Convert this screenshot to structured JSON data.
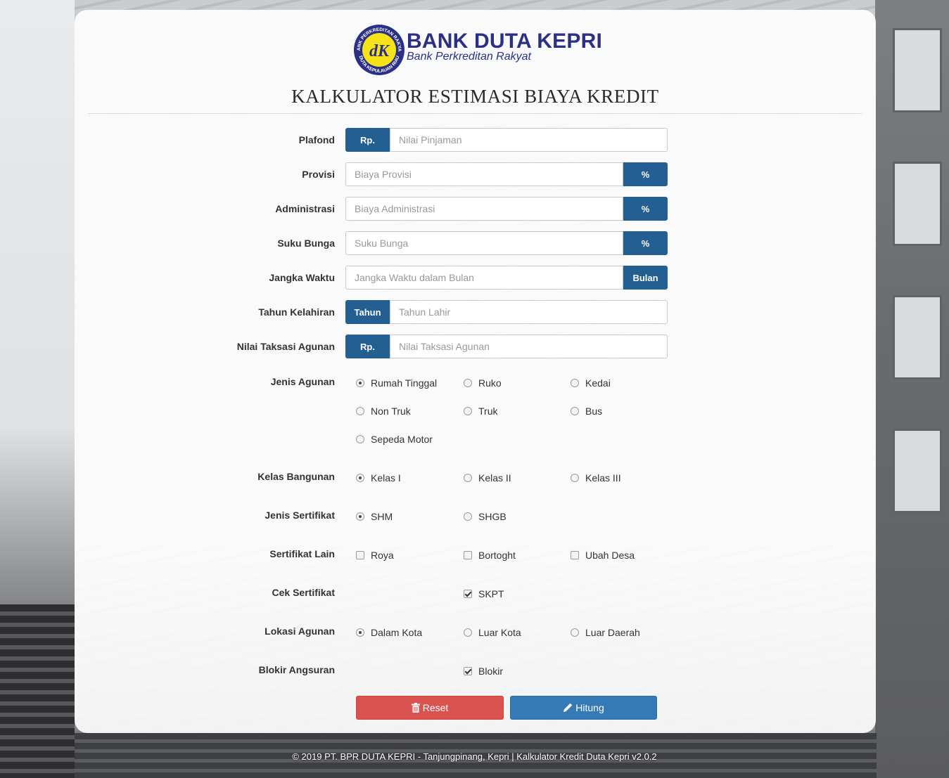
{
  "brand": {
    "name": "BANK DUTA KEPRI",
    "subtitle": "Bank Perkreditan Rakyat",
    "badge_top_text": "BANK PERKREDITAN RAKYAT",
    "badge_bottom_text": "DUTA KEPULAUAN RIAU",
    "badge_initials": "dK"
  },
  "page_title": "KALKULATOR ESTIMASI BIAYA KREDIT",
  "fields": {
    "plafond": {
      "label": "Plafond",
      "addon": "Rp.",
      "placeholder": "Nilai Pinjaman",
      "value": ""
    },
    "provisi": {
      "label": "Provisi",
      "addon": "%",
      "placeholder": "Biaya Provisi",
      "value": ""
    },
    "administrasi": {
      "label": "Administrasi",
      "addon": "%",
      "placeholder": "Biaya Administrasi",
      "value": ""
    },
    "suku_bunga": {
      "label": "Suku Bunga",
      "addon": "%",
      "placeholder": "Suku Bunga",
      "value": ""
    },
    "jangka_waktu": {
      "label": "Jangka Waktu",
      "addon": "Bulan",
      "placeholder": "Jangka Waktu dalam Bulan",
      "value": ""
    },
    "tahun_kelahiran": {
      "label": "Tahun Kelahiran",
      "addon": "Tahun",
      "placeholder": "Tahun Lahir",
      "value": ""
    },
    "nilai_taksasi": {
      "label": "Nilai Taksasi Agunan",
      "addon": "Rp.",
      "placeholder": "Nilai Taksasi Agunan",
      "value": ""
    }
  },
  "jenis_agunan": {
    "label": "Jenis Agunan",
    "options": [
      "Rumah Tinggal",
      "Ruko",
      "Kedai",
      "Non Truk",
      "Truk",
      "Bus",
      "Sepeda Motor"
    ],
    "selected": "Rumah Tinggal"
  },
  "kelas_bangunan": {
    "label": "Kelas Bangunan",
    "options": [
      "Kelas I",
      "Kelas II",
      "Kelas III"
    ],
    "selected": "Kelas I"
  },
  "jenis_sertifikat": {
    "label": "Jenis Sertifikat",
    "options": [
      "SHM",
      "SHGB"
    ],
    "selected": "SHM"
  },
  "sertifikat_lain": {
    "label": "Sertifikat Lain",
    "options": [
      "Roya",
      "Bortoght",
      "Ubah Desa"
    ],
    "checked": []
  },
  "cek_sertifikat": {
    "label": "Cek Sertifikat",
    "options": [
      "SKPT"
    ],
    "checked": [
      "SKPT"
    ]
  },
  "lokasi_agunan": {
    "label": "Lokasi Agunan",
    "options": [
      "Dalam Kota",
      "Luar Kota",
      "Luar Daerah"
    ],
    "selected": "Dalam Kota"
  },
  "blokir_angsuran": {
    "label": "Blokir Angsuran",
    "options": [
      "Blokir"
    ],
    "checked": [
      "Blokir"
    ]
  },
  "buttons": {
    "reset": "Reset",
    "hitung": "Hitung"
  },
  "footer": "© 2019 PT. BPR DUTA KEPRI - Tanjungpinang, Kepri | Kalkulator Kredit Duta Kepri v2.0.2",
  "colors": {
    "brand_navy": "#2b2f86",
    "addon_blue": "#235f90",
    "reset_red": "#d9534f",
    "hitung_blue": "#337ab7"
  }
}
